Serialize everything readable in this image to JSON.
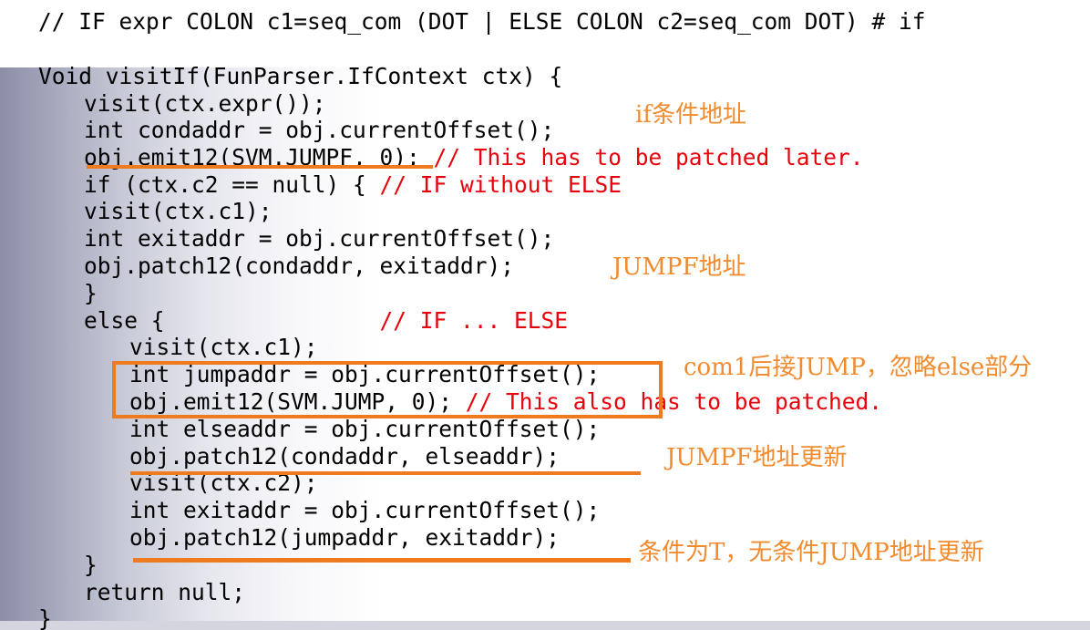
{
  "code": {
    "grammar": "// IF expr COLON c1=seq_com (DOT | ELSE COLON c2=seq_com DOT) # if",
    "lines": [
      {
        "text": "Void visitIf(FunParser.IfContext ctx) {",
        "comment": ""
      },
      {
        "text": "visit(ctx.expr());",
        "comment": ""
      },
      {
        "text": "int condaddr = obj.currentOffset();",
        "comment": ""
      },
      {
        "text": "obj.emit12(SVM.JUMPF, 0); ",
        "comment": "// This has to be patched later."
      },
      {
        "text": "if (ctx.c2 == null) { ",
        "comment": "// IF without ELSE"
      },
      {
        "text": "visit(ctx.c1);",
        "comment": ""
      },
      {
        "text": "int exitaddr = obj.currentOffset();",
        "comment": ""
      },
      {
        "text": "obj.patch12(condaddr, exitaddr);",
        "comment": ""
      },
      {
        "text": "}",
        "comment": ""
      },
      {
        "text": "else {                ",
        "comment": "// IF ... ELSE"
      },
      {
        "text": "visit(ctx.c1);",
        "comment": ""
      },
      {
        "text": "int jumpaddr = obj.currentOffset();",
        "comment": ""
      },
      {
        "text": "obj.emit12(SVM.JUMP, 0); ",
        "comment": "// This also has to be patched."
      },
      {
        "text": "int elseaddr = obj.currentOffset();",
        "comment": ""
      },
      {
        "text": "obj.patch12(condaddr, elseaddr);",
        "comment": ""
      },
      {
        "text": "visit(ctx.c2);",
        "comment": ""
      },
      {
        "text": "int exitaddr = obj.currentOffset();",
        "comment": ""
      },
      {
        "text": "obj.patch12(jumpaddr, exitaddr);",
        "comment": ""
      },
      {
        "text": "}",
        "comment": ""
      },
      {
        "text": "return null;",
        "comment": ""
      },
      {
        "text": "}",
        "comment": ""
      }
    ]
  },
  "annotations": {
    "if_cond_addr": "if条件地址",
    "jumpf_addr": "JUMPF地址",
    "com1_jump": "com1后接JUMP，忽略else部分",
    "jumpf_update": "JUMPF地址更新",
    "uncond_jump_update": "条件为T，无条件JUMP地址更新"
  },
  "colors": {
    "code": "#000000",
    "comment": "#e8000b",
    "annotation": "#f08b2f",
    "highlight": "#f07a1e"
  }
}
